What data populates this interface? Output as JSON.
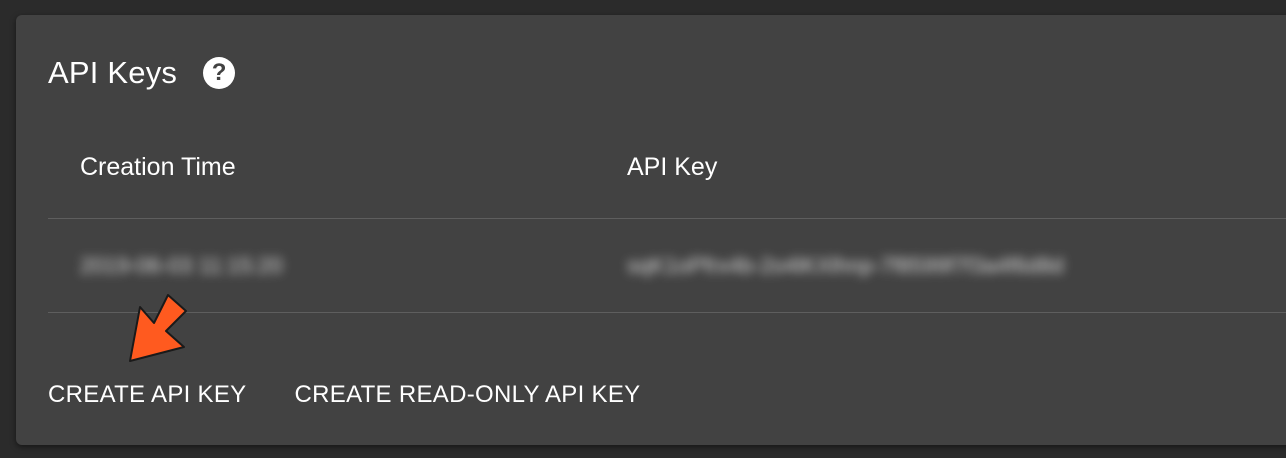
{
  "card": {
    "title": "API Keys",
    "help_icon": "help-circle-icon"
  },
  "table": {
    "columns": [
      "Creation Time",
      "API Key"
    ],
    "rows": [
      {
        "creation_time": "2019-06-03 11:15:20",
        "api_key": "sqK1oPfrx4b-2o4lKXlhnp-7f8599f7f3a4f6d8d"
      }
    ]
  },
  "actions": {
    "create_api_key": "CREATE API KEY",
    "create_read_only_api_key": "CREATE READ-ONLY API KEY"
  },
  "colors": {
    "card_background": "#424242",
    "page_background": "#2b2b2b",
    "arrow_fill": "#ff5a1f"
  }
}
